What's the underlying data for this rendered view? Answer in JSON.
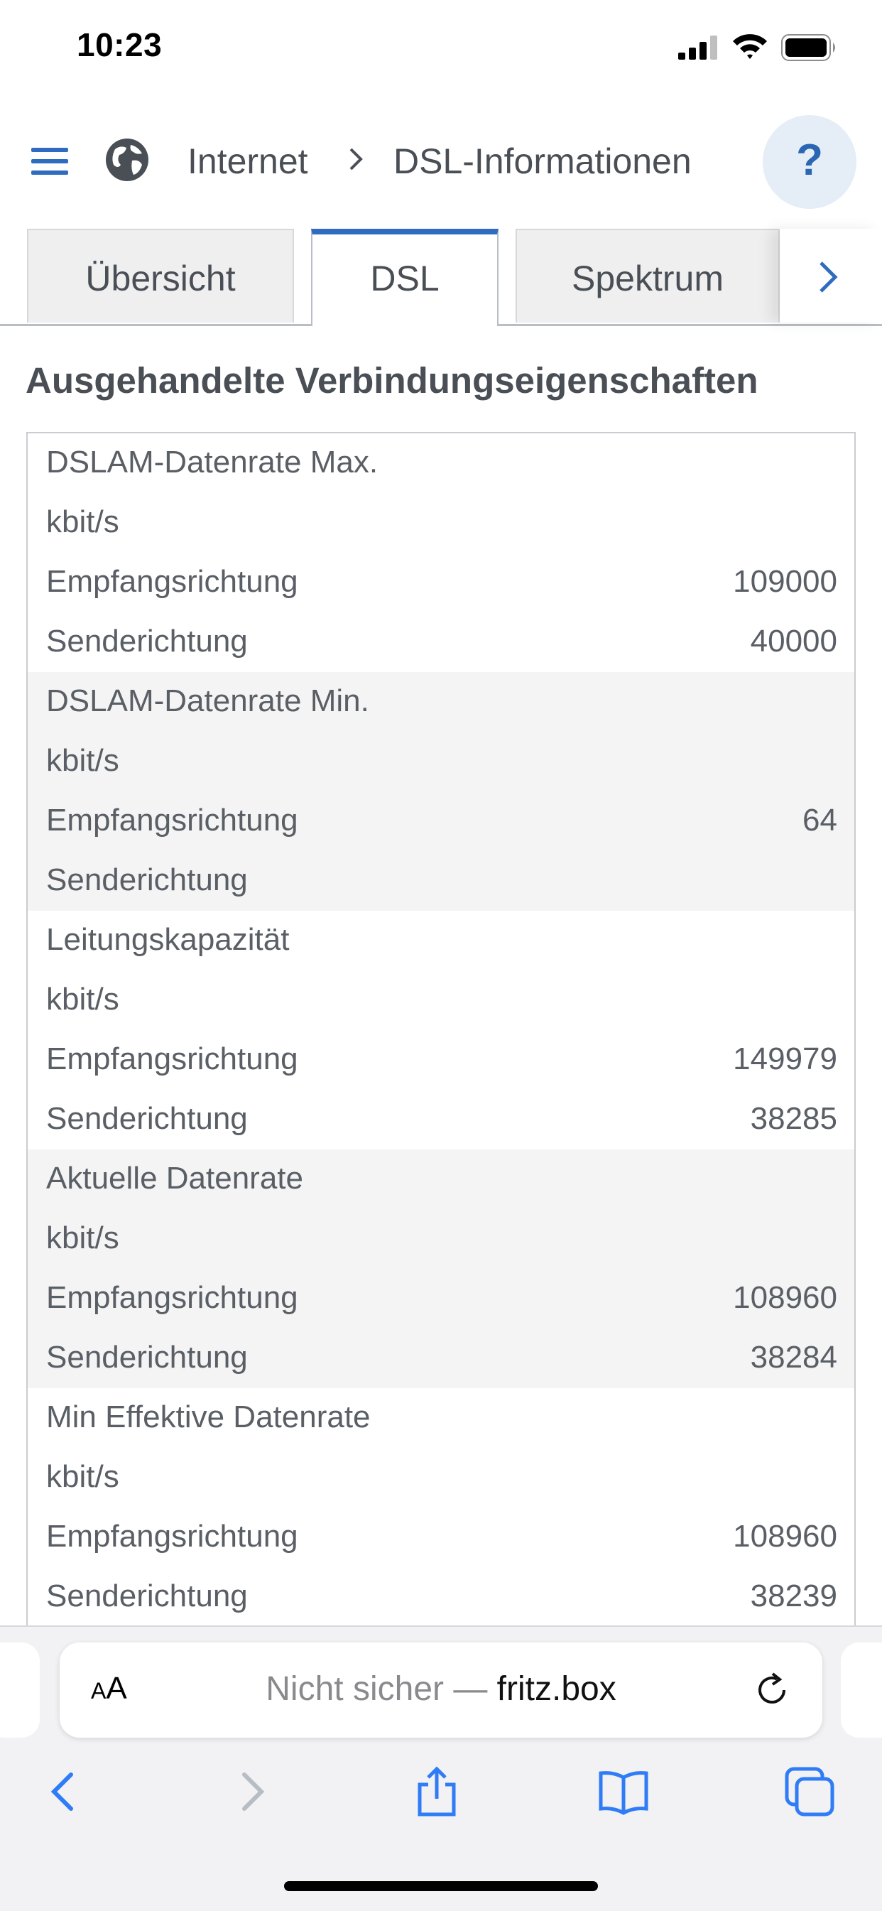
{
  "status_bar": {
    "time": "10:23"
  },
  "header": {
    "breadcrumb": [
      "Internet",
      "DSL-Informationen"
    ],
    "help_label": "?"
  },
  "tabs": [
    {
      "label": "Übersicht",
      "active": false
    },
    {
      "label": "DSL",
      "active": true
    },
    {
      "label": "Spektrum",
      "active": false
    }
  ],
  "section_title": "Ausgehandelte Verbindungseigenschaften",
  "table": {
    "groups": [
      {
        "title": "DSLAM-Datenrate Max.",
        "unit": "kbit/s",
        "rx_label": "Empfangsrichtung",
        "rx": "109000",
        "tx_label": "Senderichtung",
        "tx": "40000"
      },
      {
        "title": "DSLAM-Datenrate Min.",
        "unit": "kbit/s",
        "rx_label": "Empfangsrichtung",
        "rx": "64",
        "tx_label": "Senderichtung",
        "tx": ""
      },
      {
        "title": "Leitungskapazität",
        "unit": "kbit/s",
        "rx_label": "Empfangsrichtung",
        "rx": "149979",
        "tx_label": "Senderichtung",
        "tx": "38285"
      },
      {
        "title": "Aktuelle Datenrate",
        "unit": "kbit/s",
        "rx_label": "Empfangsrichtung",
        "rx": "108960",
        "tx_label": "Senderichtung",
        "tx": "38284"
      },
      {
        "title": "Min Effektive Datenrate",
        "unit": "kbit/s",
        "rx_label": "Empfangsrichtung",
        "rx": "108960",
        "tx_label": "Senderichtung",
        "tx": "38239"
      }
    ]
  },
  "browser": {
    "aa_big": "A",
    "aa_small": "A",
    "url_prefix": "Nicht sicher — ",
    "url_host": "fritz.box"
  },
  "colors": {
    "accent": "#2f6cc0",
    "safari_blue": "#2f7cf6",
    "alt_row": "#f4f4f4"
  }
}
